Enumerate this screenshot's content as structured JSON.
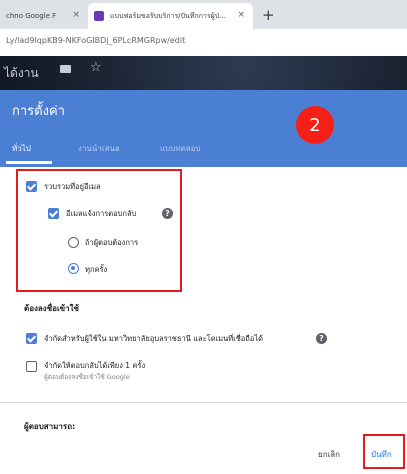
{
  "browser": {
    "tab1_title": "chno Google F",
    "tab2_title": "แบบฟอร์มขอรับบริการ/บันทึกการผู้ป่...",
    "new_tab": "+",
    "close": "×",
    "url": "Ly/lad9IqpKB9-NKFoGIBDj_6PLcRMGRpw/edit"
  },
  "form_header": {
    "title": "ได้งาน"
  },
  "dialog": {
    "title": "การตั้งค่า",
    "badge": "2",
    "tabs": [
      "ทั่วไป",
      "งานนำเสนอ",
      "แบบทดสอบ"
    ],
    "collect_email": "รวบรวมที่อยู่อีเมล",
    "email_receipt": "อีเมลแจ้งการตอบกลับ",
    "option_if_requested": "ถ้าผู้ตอบต้องการ",
    "option_always": "ทุกครั้ง",
    "requires_signin": "ต้องลงชื่อเข้าใช้",
    "restrict_users": "จำกัดสำหรับผู้ใช้ใน มหาวิทยาลัยอุบลราชธานี และโดเมนที่เชื่อถือได้",
    "limit_one_response": "จำกัดให้ตอบกลับได้เพียง 1 ครั้ง",
    "limit_one_sub": "ผู้ตอบต้องลงชื่อเข้าใช้ Google",
    "respondents_can": "ผู้ตอบสามารถ:",
    "cancel": "ยกเลิก",
    "save": "บันทึก",
    "help": "?"
  },
  "colors": {
    "accent": "#4a7fd4",
    "highlight": "#e31b1b",
    "badge": "#f52015"
  }
}
